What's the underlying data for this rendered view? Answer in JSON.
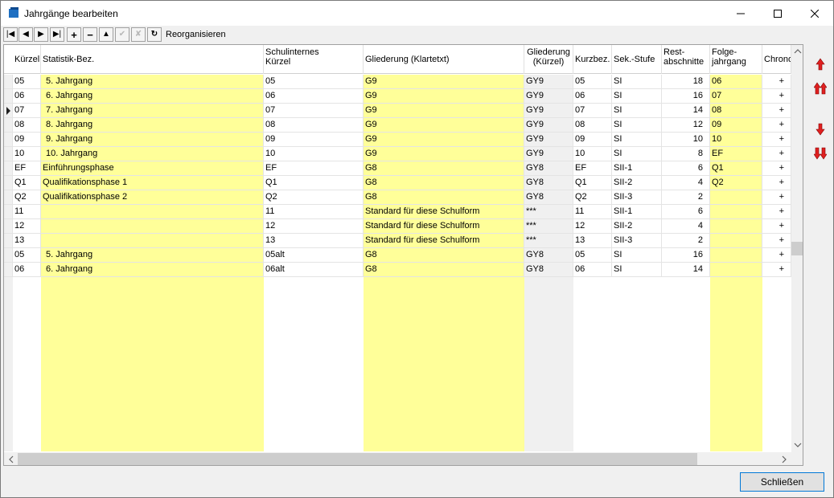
{
  "window": {
    "title": "Jahrgänge bearbeiten",
    "minimize_icon": "minimize-icon",
    "maximize_icon": "maximize-icon",
    "close_icon": "close-icon"
  },
  "toolbar": {
    "reorganize_label": "Reorganisieren",
    "buttons": [
      "first-record-icon",
      "previous-record-icon",
      "next-record-icon",
      "last-record-icon",
      "insert-record-icon",
      "delete-record-icon",
      "edit-record-icon",
      "post-edit-icon",
      "cancel-edit-icon",
      "refresh-icon"
    ]
  },
  "table": {
    "headers": [
      "Kürzel",
      "Statistik-Bez.",
      "Schulinternes\nKürzel",
      "Gliederung (Klartetxt)",
      "Gliederung\n(Kürzel)",
      "Kurzbez.",
      "Sek.-Stufe",
      "Rest-\nabschnitte",
      "Folge-\njahrgang",
      "Chronologie"
    ],
    "rows": [
      [
        "05",
        "5. Jahrgang",
        "05",
        "G9",
        "GY9",
        "05",
        "SI",
        "18",
        "06",
        "+"
      ],
      [
        "06",
        "6. Jahrgang",
        "06",
        "G9",
        "GY9",
        "06",
        "SI",
        "16",
        "07",
        "+"
      ],
      [
        "07",
        "7. Jahrgang",
        "07",
        "G9",
        "GY9",
        "07",
        "SI",
        "14",
        "08",
        "+"
      ],
      [
        "08",
        "8. Jahrgang",
        "08",
        "G9",
        "GY9",
        "08",
        "SI",
        "12",
        "09",
        "+"
      ],
      [
        "09",
        "9. Jahrgang",
        "09",
        "G9",
        "GY9",
        "09",
        "SI",
        "10",
        "10",
        "+"
      ],
      [
        "10",
        "10. Jahrgang",
        "10",
        "G9",
        "GY9",
        "10",
        "SI",
        "8",
        "EF",
        "+"
      ],
      [
        "EF",
        "Einführungsphase",
        "EF",
        "G8",
        "GY8",
        "EF",
        "SII-1",
        "6",
        "Q1",
        "+"
      ],
      [
        "Q1",
        "Qualifikationsphase 1",
        "Q1",
        "G8",
        "GY8",
        "Q1",
        "SII-2",
        "4",
        "Q2",
        "+"
      ],
      [
        "Q2",
        "Qualifikationsphase 2",
        "Q2",
        "G8",
        "GY8",
        "Q2",
        "SII-3",
        "2",
        "",
        "+"
      ],
      [
        "11",
        "",
        "11",
        "Standard für diese Schulform",
        "***",
        "11",
        "SII-1",
        "6",
        "",
        "+"
      ],
      [
        "12",
        "",
        "12",
        "Standard für diese Schulform",
        "***",
        "12",
        "SII-2",
        "4",
        "",
        "+"
      ],
      [
        "13",
        "",
        "13",
        "Standard für diese Schulform",
        "***",
        "13",
        "SII-3",
        "2",
        "",
        "+"
      ],
      [
        "05",
        "5. Jahrgang",
        "05alt",
        "G8",
        "GY8",
        "05",
        "SI",
        "16",
        "",
        "+"
      ],
      [
        "06",
        "6. Jahrgang",
        "06alt",
        "G8",
        "GY8",
        "06",
        "SI",
        "14",
        "",
        "+"
      ]
    ],
    "current_row_marker": 2,
    "colors": {
      "yellow": "#ffff99",
      "readonly": "#f0f0f0",
      "white": "#ffffff"
    }
  },
  "side": {
    "icons": [
      "move-up-icon",
      "move-to-top-icon",
      "move-down-icon",
      "move-to-bottom-icon"
    ]
  },
  "footer": {
    "close_label": "Schließen"
  }
}
